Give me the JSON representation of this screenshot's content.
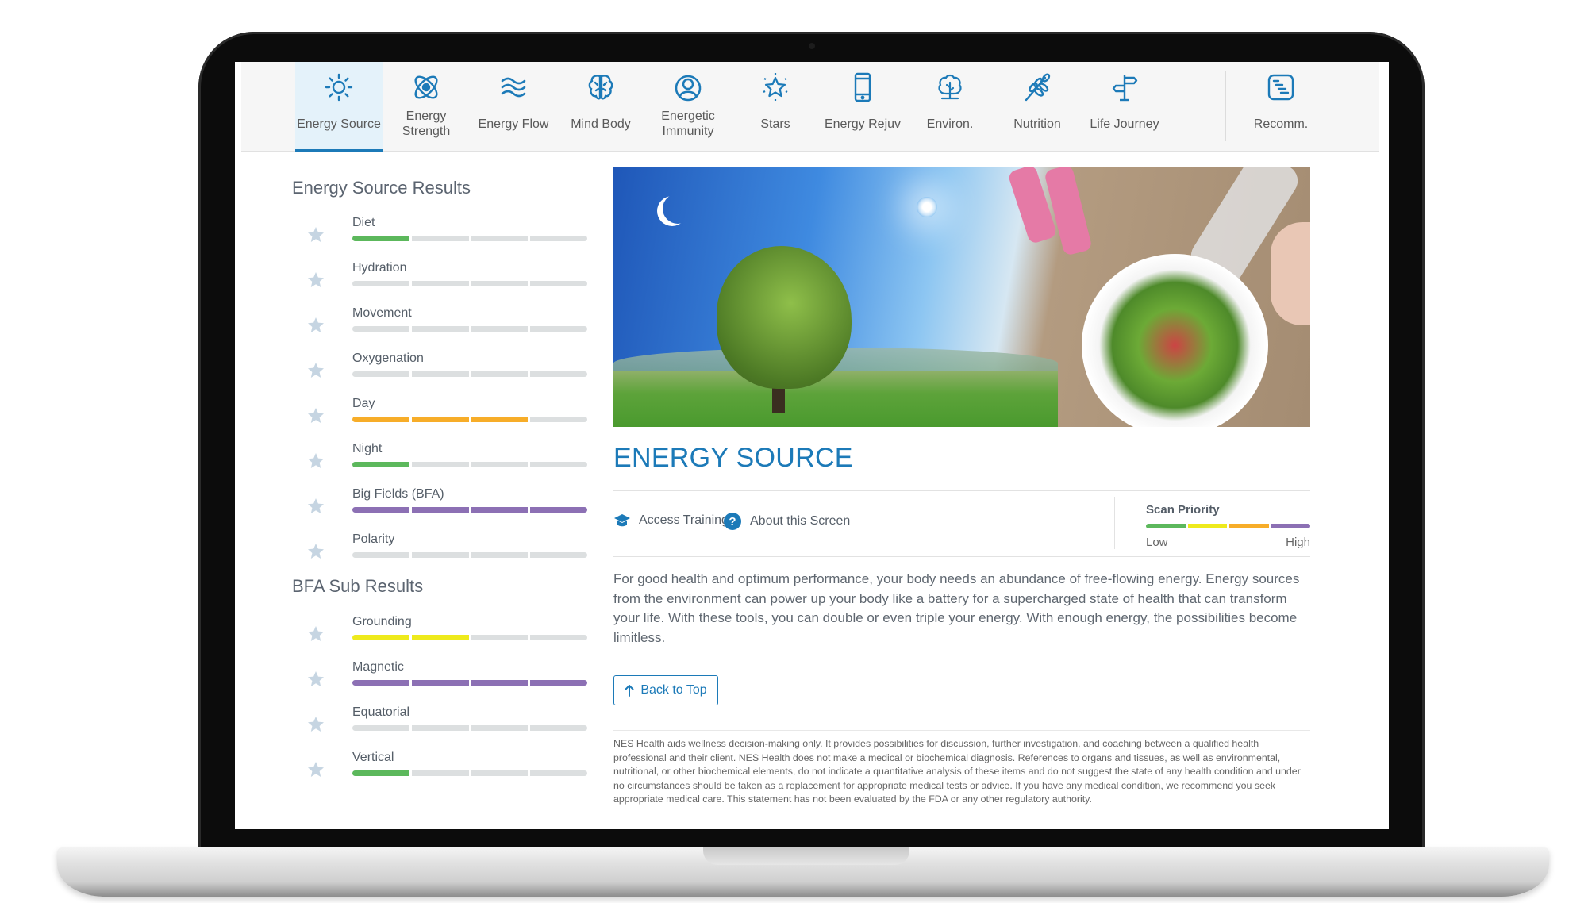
{
  "colors": {
    "accent": "#1c7ab8",
    "green": "#5cb85c",
    "yellow": "#eeea1c",
    "orange": "#f7ad29",
    "purple": "#8c70b4",
    "empty": "#dcdfe0",
    "star": "#c6d5e2"
  },
  "nav": {
    "tabs": [
      {
        "label": "Energy Source",
        "icon": "sun-icon",
        "active": true
      },
      {
        "label": "Energy Strength",
        "icon": "atom-icon",
        "active": false
      },
      {
        "label": "Energy Flow",
        "icon": "waves-icon",
        "active": false
      },
      {
        "label": "Mind Body",
        "icon": "brain-icon",
        "active": false
      },
      {
        "label": "Energetic Immunity",
        "icon": "person-circle-icon",
        "active": false
      },
      {
        "label": "Stars",
        "icon": "star-icon",
        "active": false
      },
      {
        "label": "Energy Rejuv",
        "icon": "phone-icon",
        "active": false
      },
      {
        "label": "Environ.",
        "icon": "trees-icon",
        "active": false
      },
      {
        "label": "Nutrition",
        "icon": "wheat-icon",
        "active": false
      },
      {
        "label": "Life Journey",
        "icon": "signpost-icon",
        "active": false
      },
      {
        "label": "Recomm.",
        "icon": "list-document-icon",
        "active": false
      }
    ]
  },
  "results": {
    "title": "Energy Source Results",
    "items": [
      {
        "name": "Diet",
        "level": 1,
        "color": "green"
      },
      {
        "name": "Hydration",
        "level": 0,
        "color": "empty"
      },
      {
        "name": "Movement",
        "level": 0,
        "color": "empty"
      },
      {
        "name": "Oxygenation",
        "level": 0,
        "color": "empty"
      },
      {
        "name": "Day",
        "level": 3,
        "color": "orange"
      },
      {
        "name": "Night",
        "level": 1,
        "color": "green"
      },
      {
        "name": "Big Fields (BFA)",
        "level": 4,
        "color": "purple"
      },
      {
        "name": "Polarity",
        "level": 0,
        "color": "empty"
      }
    ]
  },
  "bfa": {
    "title": "BFA Sub Results",
    "items": [
      {
        "name": "Grounding",
        "level": 2,
        "color": "yellow"
      },
      {
        "name": "Magnetic",
        "level": 4,
        "color": "purple"
      },
      {
        "name": "Equatorial",
        "level": 0,
        "color": "empty"
      },
      {
        "name": "Vertical",
        "level": 1,
        "color": "green"
      }
    ]
  },
  "main": {
    "title": "ENERGY SOURCE",
    "access_training": "Access Training",
    "about_screen": "About this Screen",
    "scan_priority": {
      "title": "Scan Priority",
      "low": "Low",
      "high": "High",
      "scale": [
        "green",
        "yellow",
        "orange",
        "purple"
      ]
    },
    "description": "For good health and optimum performance, your body needs an abundance of free-flowing energy. Energy sources from the environment can power up your body like a battery for a supercharged state of health that can transform your life. With these tools, you can double or even triple your energy. With enough energy, the possibilities become limitless.",
    "back_to_top": "Back to Top",
    "disclaimer": "NES Health aids wellness decision-making only. It provides possibilities for discussion, further investigation, and coaching between a qualified health professional and their client. NES Health does not make a medical or biochemical diagnosis. References to organs and tissues, as well as environmental, nutritional, or other biochemical elements, do not indicate a quantitative analysis of these items and do not suggest the state of any health condition and under no circumstances should be taken as a replacement for appropriate medical tests or advice. If you have any medical condition, we recommend you seek appropriate medical care. This statement has not been evaluated by the FDA or any other regulatory authority."
  }
}
